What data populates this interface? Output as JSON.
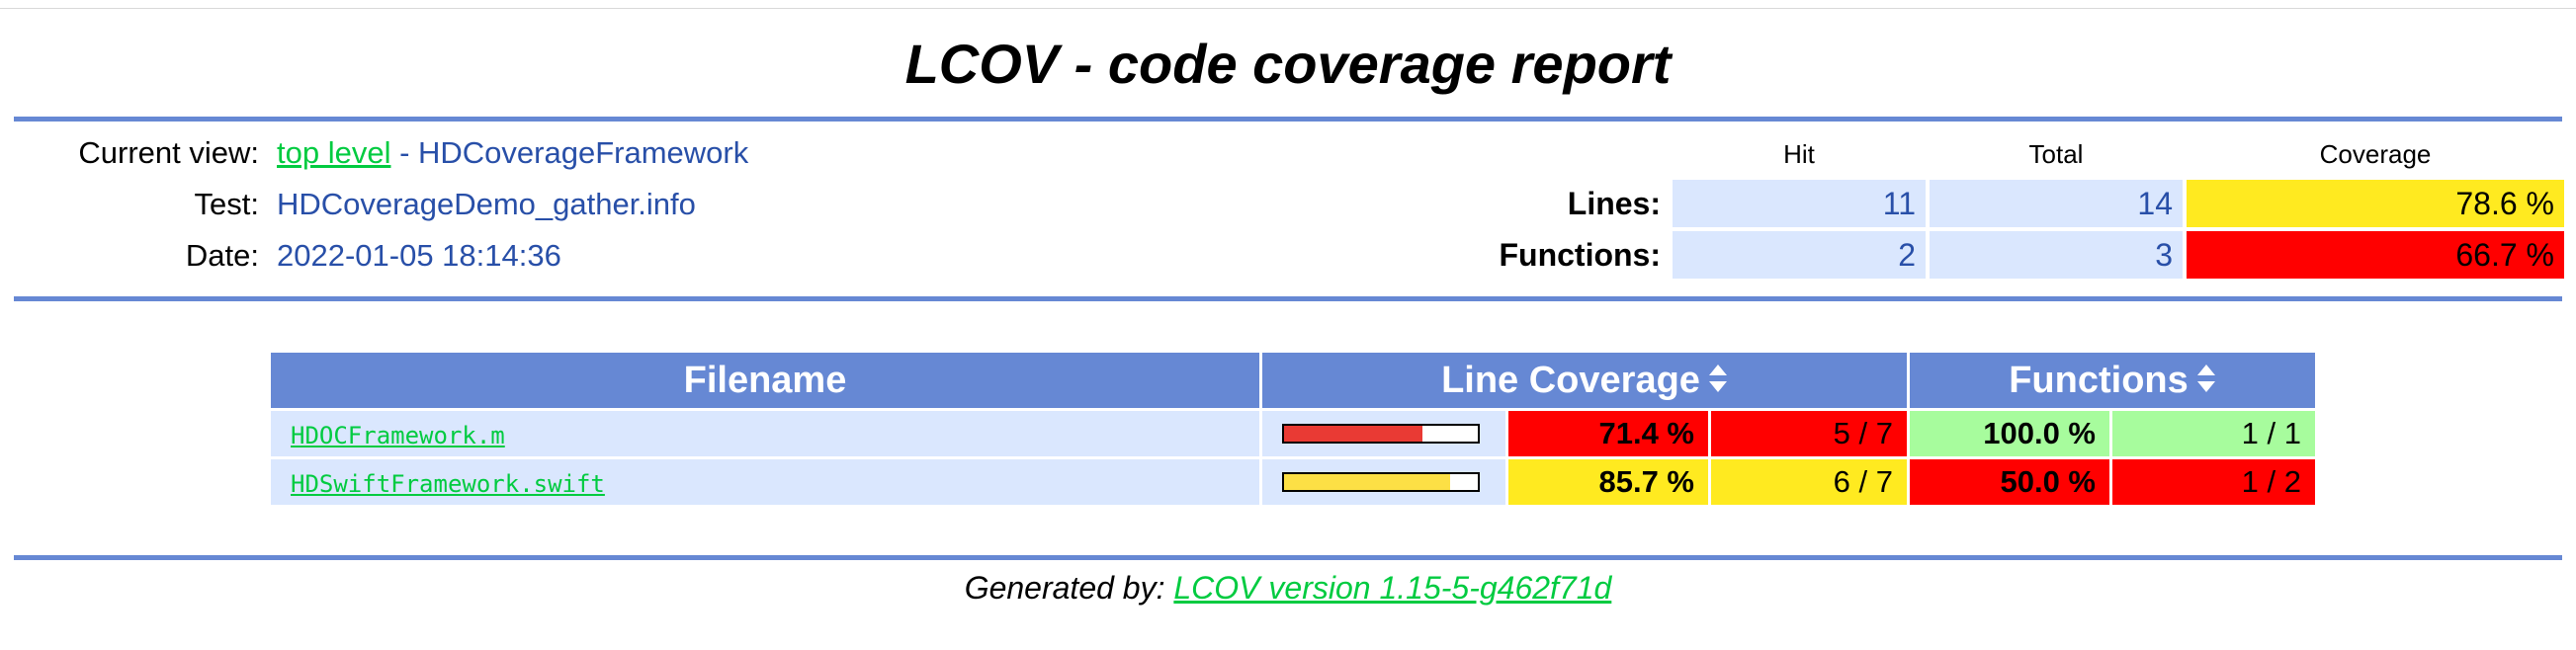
{
  "page": {
    "title": "LCOV - code coverage report"
  },
  "header": {
    "current_view_label": "Current view:",
    "current_view_link": "top level",
    "current_view_sep": " - HDCoverageFramework",
    "test_label": "Test:",
    "test_value": "HDCoverageDemo_gather.info",
    "date_label": "Date:",
    "date_value": "2022-01-05 18:14:36"
  },
  "summary": {
    "col_hit": "Hit",
    "col_total": "Total",
    "col_coverage": "Coverage",
    "lines_label": "Lines:",
    "lines_hit": "11",
    "lines_total": "14",
    "lines_coverage": "78.6 %",
    "functions_label": "Functions:",
    "functions_hit": "2",
    "functions_total": "3",
    "functions_coverage": "66.7 %"
  },
  "table": {
    "col_filename": "Filename",
    "col_line_coverage": "Line Coverage",
    "col_functions": "Functions",
    "rows": [
      {
        "filename": "HDOCFramework.m",
        "line_pct": "71.4 %",
        "line_ratio": "5 / 7",
        "line_fraction": 0.714,
        "func_pct": "100.0 %",
        "func_ratio": "1 / 1"
      },
      {
        "filename": "HDSwiftFramework.swift",
        "line_pct": "85.7 %",
        "line_ratio": "6 / 7",
        "line_fraction": 0.857,
        "func_pct": "50.0 %",
        "func_ratio": "1 / 2"
      }
    ]
  },
  "colors": {
    "rule": "#6688d4",
    "link": "#00cb40",
    "value_blue": "#284fa8",
    "cell_blue": "#dae7fe",
    "low": "#ff0000",
    "medium": "#ffea20",
    "high": "#a7fc9d",
    "bar_low": "#e93a34",
    "bar_medium": "#fde045"
  },
  "icons": {
    "sort": "sort-up-down-icon"
  },
  "footer": {
    "prefix": "Generated by: ",
    "link": "LCOV version 1.15-5-g462f71d"
  }
}
